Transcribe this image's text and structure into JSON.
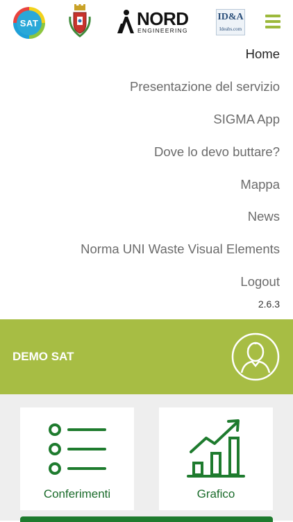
{
  "header": {
    "logos": {
      "sat_text": "SAT",
      "nord_main": "NORD",
      "nord_sub": "ENGINEERING",
      "idea_main": "ID&A",
      "idea_sub": "Ideabs.com"
    },
    "menu_icon": "hamburger-icon"
  },
  "menu": {
    "items": [
      {
        "label": "Home"
      },
      {
        "label": "Presentazione del servizio"
      },
      {
        "label": "SIGMA App"
      },
      {
        "label": "Dove lo devo buttare?"
      },
      {
        "label": "Mappa"
      },
      {
        "label": "News"
      },
      {
        "label": "Norma UNI Waste Visual Elements"
      },
      {
        "label": "Logout"
      }
    ],
    "version": "2.6.3"
  },
  "banner": {
    "title": "DEMO SAT",
    "icon": "user-avatar-icon"
  },
  "cards": [
    {
      "label": "Conferimenti",
      "icon": "list-icon"
    },
    {
      "label": "Grafico",
      "icon": "bar-chart-trend-icon"
    }
  ],
  "colors": {
    "accent_green": "#a7bd44",
    "dark_green": "#1e7b2e",
    "menu_text": "#6b6b6b",
    "active_text": "#222222"
  }
}
